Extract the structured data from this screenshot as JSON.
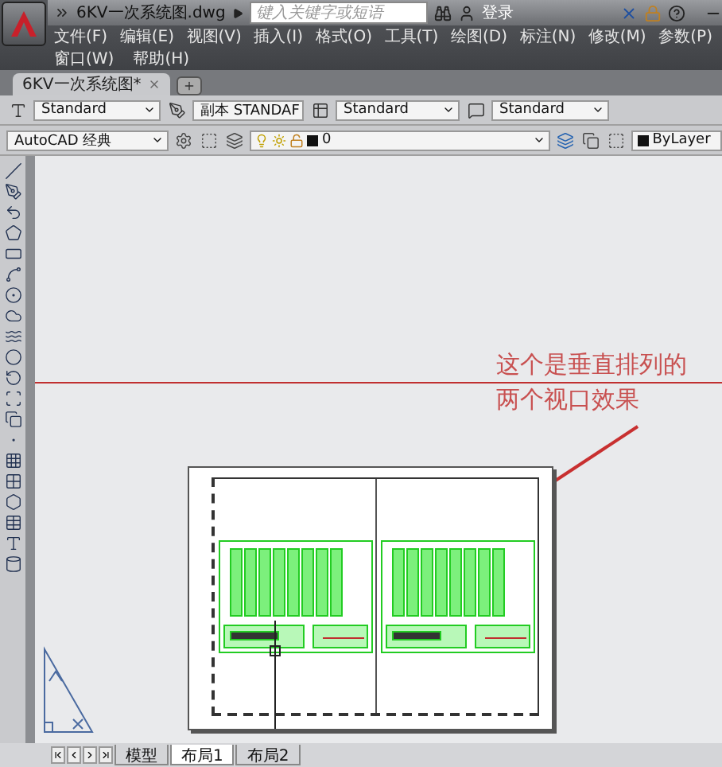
{
  "title_bar": {
    "title": "6KV一次系统图.dwg",
    "search": {
      "placeholder": "键入关键字或短语"
    },
    "login": "登录"
  },
  "menu": {
    "rows": [
      [
        "文件(F)",
        "编辑(E)",
        "视图(V)",
        "插入(I)",
        "格式(O)",
        "工具(T)",
        "绘图(D)",
        "标注(N)",
        "修改(M)",
        "参数(P)"
      ],
      [
        "窗口(W)",
        "帮助(H)"
      ]
    ]
  },
  "doc_tabs": [
    {
      "label": "6KV一次系统图*",
      "selected": true
    }
  ],
  "style_toolbar": [
    {
      "kind": "text",
      "value": "Standard"
    },
    {
      "kind": "dim",
      "value": "副本 STANDAF"
    },
    {
      "kind": "table",
      "value": "Standard"
    },
    {
      "kind": "multileader",
      "value": "Standard"
    }
  ],
  "workspace": "AutoCAD 经典",
  "layer": "0",
  "color_setting": "ByLayer",
  "annotation": [
    "这个是垂直排列的",
    "两个视口效果"
  ],
  "layout_tabs": [
    {
      "label": "模型",
      "selected": false
    },
    {
      "label": "布局1",
      "selected": true
    },
    {
      "label": "布局2",
      "selected": false
    }
  ]
}
